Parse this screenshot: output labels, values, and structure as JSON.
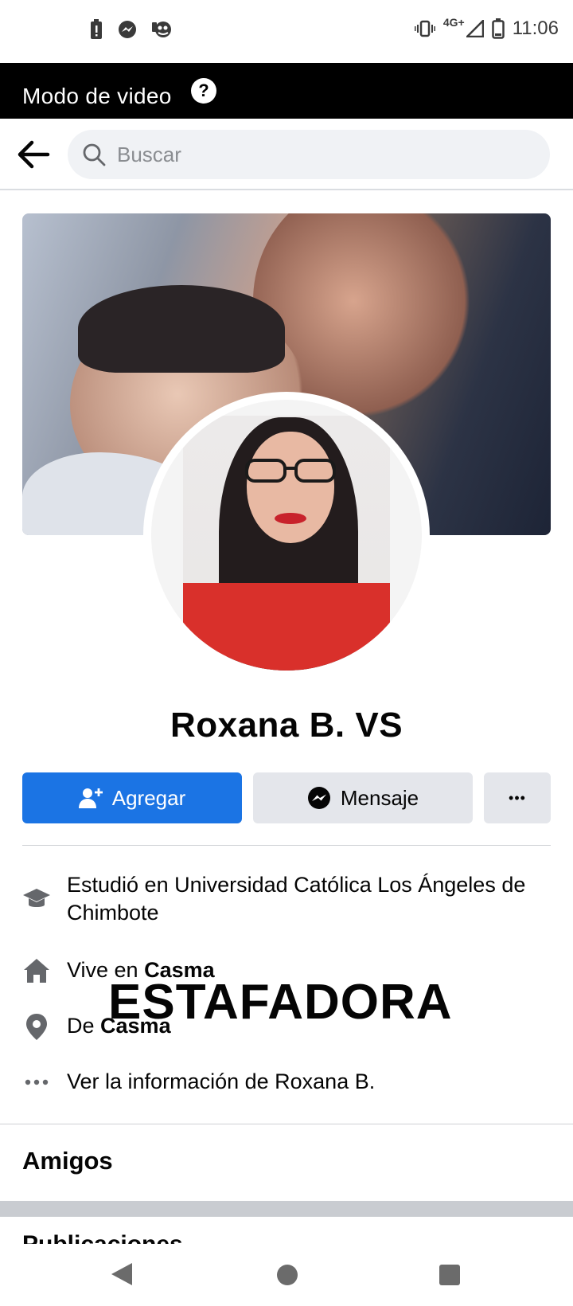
{
  "status_bar": {
    "time": "11:06",
    "network": "4G+",
    "icons": [
      "alert-battery-icon",
      "messenger-notification-icon",
      "app-notification-icon",
      "vibrate-icon",
      "signal-icon",
      "battery-icon"
    ]
  },
  "video_bar": {
    "label": "Modo de video",
    "help_symbol": "?"
  },
  "search": {
    "placeholder": "Buscar"
  },
  "profile": {
    "name": "Roxana B. VS"
  },
  "actions": {
    "add_label": "Agregar",
    "message_label": "Mensaje",
    "more_symbol": "•••"
  },
  "info": {
    "education": "Estudió en Universidad Católica Los Ángeles de Chimbote",
    "lives_prefix": "Vive en ",
    "lives_city": "Casma",
    "from_prefix": "De ",
    "from_city": "Casma",
    "see_info": "Ver la información de Roxana B."
  },
  "overlay_text": "ESTAFADORA",
  "sections": {
    "friends_title": "Amigos",
    "next_title_peek": "Publicaciones"
  },
  "colors": {
    "primary_button": "#1b74e4",
    "secondary_button": "#e4e6eb",
    "video_bar": "#000000"
  }
}
